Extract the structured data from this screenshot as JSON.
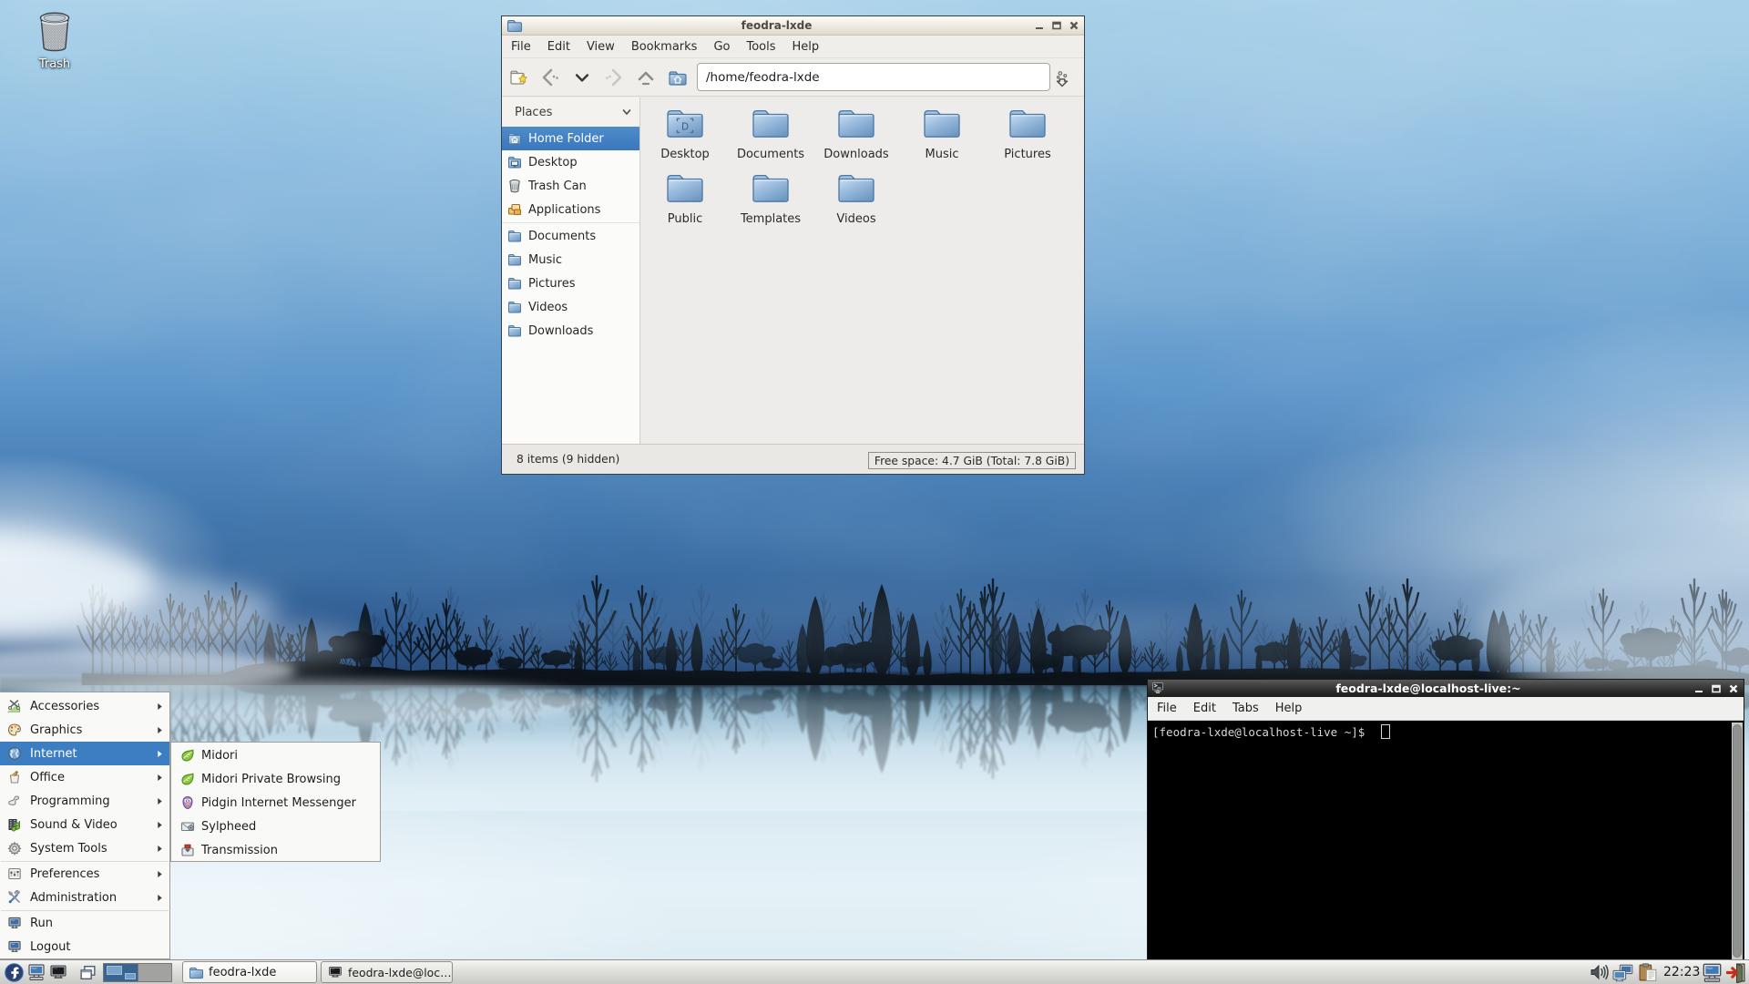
{
  "desktop": {
    "trash_label": "Trash",
    "wallpaper_colors": {
      "sky_top": "#a3cde8",
      "sky_deep": "#315f95",
      "water_fog": "#dcebf3",
      "trees": "#141d27"
    }
  },
  "file_manager": {
    "title": "feodra-lxde",
    "menu": [
      "File",
      "Edit",
      "View",
      "Bookmarks",
      "Go",
      "Tools",
      "Help"
    ],
    "toolbar_icons": [
      "new-tab-icon",
      "back-icon",
      "history-down-icon",
      "forward-icon",
      "up-icon",
      "home-icon",
      "jump-icon"
    ],
    "path_value": "/home/feodra-lxde",
    "places_header": "Places",
    "places": [
      {
        "label": "Home Folder",
        "icon": "home-folder-icon",
        "selected": true
      },
      {
        "label": "Desktop",
        "icon": "desktop-folder-icon",
        "selected": false
      },
      {
        "label": "Trash Can",
        "icon": "trash-icon",
        "selected": false
      },
      {
        "label": "Applications",
        "icon": "applications-icon",
        "selected": false
      },
      {
        "label": "Documents",
        "icon": "folder-icon",
        "selected": false
      },
      {
        "label": "Music",
        "icon": "folder-icon",
        "selected": false
      },
      {
        "label": "Pictures",
        "icon": "folder-icon",
        "selected": false
      },
      {
        "label": "Videos",
        "icon": "folder-icon",
        "selected": false
      },
      {
        "label": "Downloads",
        "icon": "folder-icon",
        "selected": false
      }
    ],
    "folders_row1": [
      "Desktop",
      "Documents",
      "Downloads",
      "Music",
      "Pictures"
    ],
    "folders_row2": [
      "Public",
      "Templates",
      "Videos"
    ],
    "status_left": "8 items (9 hidden)",
    "status_right": "Free space: 4.7 GiB (Total: 7.8 GiB)",
    "selection_color": "#3d7fc4",
    "folder_color": "#85acd3"
  },
  "terminal": {
    "title": "feodra-lxde@localhost-live:~",
    "menu": [
      "File",
      "Edit",
      "Tabs",
      "Help"
    ],
    "prompt": "[feodra-lxde@localhost-live ~]$",
    "background": "#000000",
    "foreground": "#d7d7d7"
  },
  "start_menu": {
    "items": [
      {
        "label": "Accessories",
        "icon": "accessories-icon",
        "has_submenu": true,
        "highlighted": false
      },
      {
        "label": "Graphics",
        "icon": "graphics-icon",
        "has_submenu": true,
        "highlighted": false
      },
      {
        "label": "Internet",
        "icon": "internet-globe-icon",
        "has_submenu": true,
        "highlighted": true
      },
      {
        "label": "Office",
        "icon": "office-icon",
        "has_submenu": true,
        "highlighted": false
      },
      {
        "label": "Programming",
        "icon": "programming-icon",
        "has_submenu": true,
        "highlighted": false
      },
      {
        "label": "Sound & Video",
        "icon": "sound-video-icon",
        "has_submenu": true,
        "highlighted": false
      },
      {
        "label": "System Tools",
        "icon": "system-tools-icon",
        "has_submenu": true,
        "highlighted": false
      },
      {
        "label": "Preferences",
        "icon": "preferences-icon",
        "has_submenu": true,
        "highlighted": false
      },
      {
        "label": "Administration",
        "icon": "administration-icon",
        "has_submenu": true,
        "highlighted": false
      },
      {
        "label": "Run",
        "icon": "run-icon",
        "has_submenu": false,
        "highlighted": false
      },
      {
        "label": "Logout",
        "icon": "logout-icon",
        "has_submenu": false,
        "highlighted": false
      }
    ],
    "submenu": [
      {
        "label": "Midori",
        "icon": "midori-icon"
      },
      {
        "label": "Midori Private Browsing",
        "icon": "midori-icon"
      },
      {
        "label": "Pidgin Internet Messenger",
        "icon": "pidgin-icon"
      },
      {
        "label": "Sylpheed",
        "icon": "sylpheed-icon"
      },
      {
        "label": "Transmission",
        "icon": "transmission-icon"
      }
    ],
    "highlight_color": "#3d7ec3"
  },
  "taskbar": {
    "tasks": [
      {
        "label": "feodra-lxde",
        "icon": "folder-icon",
        "active": true
      },
      {
        "label": "feodra-lxde@loc…",
        "icon": "terminal-monitor-icon",
        "active": false
      }
    ],
    "tray_icons": [
      "volume-icon",
      "network-icon",
      "clipboard-icon",
      "display-icon",
      "logout-door-icon"
    ],
    "clock": "22:23"
  }
}
